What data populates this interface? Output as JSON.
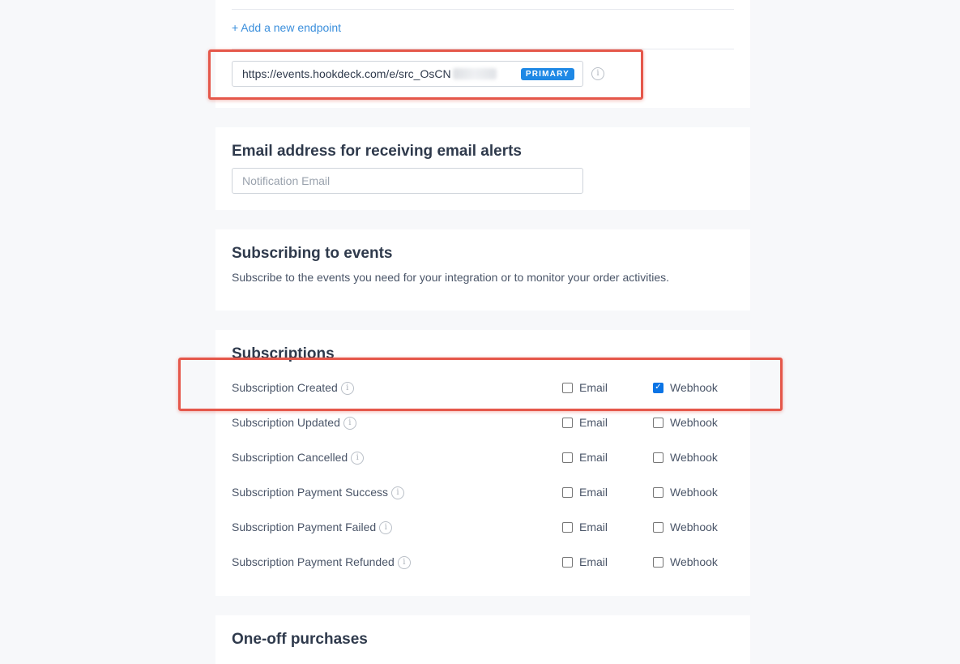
{
  "endpoints": {
    "add_link": "+ Add a new endpoint",
    "url": "https://events.hookdeck.com/e/src_OsCN",
    "badge": "PRIMARY",
    "info_glyph": "i"
  },
  "email_section": {
    "title": "Email address for receiving email alerts",
    "placeholder": "Notification Email"
  },
  "events_section": {
    "title": "Subscribing to events",
    "description": "Subscribe to the events you need for your integration or to monitor your order activities."
  },
  "subscriptions": {
    "title": "Subscriptions",
    "email_label": "Email",
    "webhook_label": "Webhook",
    "info_glyph": "i",
    "check_glyph": "✓",
    "items": [
      {
        "label": "Subscription Created",
        "email": false,
        "webhook": true
      },
      {
        "label": "Subscription Updated",
        "email": false,
        "webhook": false
      },
      {
        "label": "Subscription Cancelled",
        "email": false,
        "webhook": false
      },
      {
        "label": "Subscription Payment Success",
        "email": false,
        "webhook": false
      },
      {
        "label": "Subscription Payment Failed",
        "email": false,
        "webhook": false
      },
      {
        "label": "Subscription Payment Refunded",
        "email": false,
        "webhook": false
      }
    ]
  },
  "oneoff_section": {
    "title": "One-off purchases"
  },
  "colors": {
    "link": "#3b8fdc",
    "badge": "#1e88e5",
    "highlight": "#e5574a",
    "checkbox_checked": "#0b74e5"
  }
}
